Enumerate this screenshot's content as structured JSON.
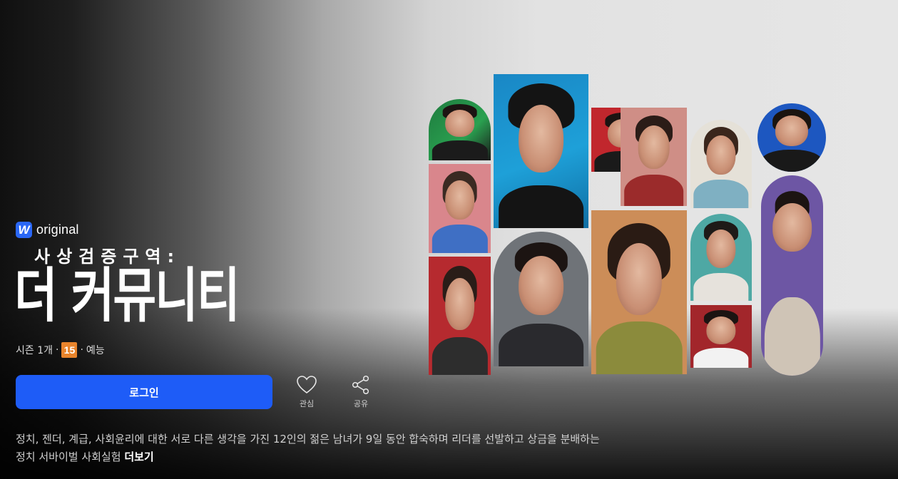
{
  "brand": {
    "logo_letter": "W",
    "logo_text": "original"
  },
  "title": {
    "subtitle": "사상검증구역:",
    "main": "더 커뮤니티"
  },
  "meta": {
    "season": "시즌 1개",
    "sep1": "·",
    "rating": "15",
    "sep2": "·",
    "genre": "예능"
  },
  "colors": {
    "accent": "#1e5cf7",
    "rating_bg": "#e8842c"
  },
  "actions": {
    "login_label": "로그인",
    "like_label": "관심",
    "like_icon": "heart-icon",
    "share_label": "공유",
    "share_icon": "share-icon"
  },
  "description": {
    "text": "정치, 젠더, 계급, 사회윤리에 대한 서로 다른 생각을 가진 12인의 젊은 남녀가 9일 동안 합숙하며 리더를 선발하고 상금을 분배하는 정치 서바이벌 사회실험",
    "more_label": "더보기"
  }
}
